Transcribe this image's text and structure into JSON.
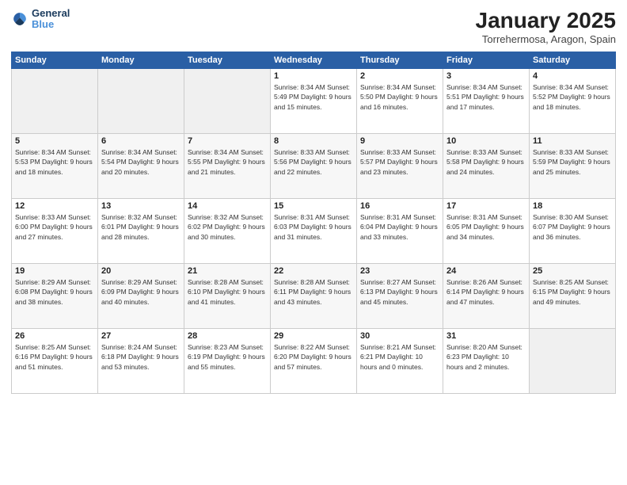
{
  "logo": {
    "line1": "General",
    "line2": "Blue"
  },
  "title": "January 2025",
  "subtitle": "Torrehermosa, Aragon, Spain",
  "days_of_week": [
    "Sunday",
    "Monday",
    "Tuesday",
    "Wednesday",
    "Thursday",
    "Friday",
    "Saturday"
  ],
  "weeks": [
    [
      {
        "day": "",
        "info": ""
      },
      {
        "day": "",
        "info": ""
      },
      {
        "day": "",
        "info": ""
      },
      {
        "day": "1",
        "info": "Sunrise: 8:34 AM\nSunset: 5:49 PM\nDaylight: 9 hours\nand 15 minutes."
      },
      {
        "day": "2",
        "info": "Sunrise: 8:34 AM\nSunset: 5:50 PM\nDaylight: 9 hours\nand 16 minutes."
      },
      {
        "day": "3",
        "info": "Sunrise: 8:34 AM\nSunset: 5:51 PM\nDaylight: 9 hours\nand 17 minutes."
      },
      {
        "day": "4",
        "info": "Sunrise: 8:34 AM\nSunset: 5:52 PM\nDaylight: 9 hours\nand 18 minutes."
      }
    ],
    [
      {
        "day": "5",
        "info": "Sunrise: 8:34 AM\nSunset: 5:53 PM\nDaylight: 9 hours\nand 18 minutes."
      },
      {
        "day": "6",
        "info": "Sunrise: 8:34 AM\nSunset: 5:54 PM\nDaylight: 9 hours\nand 20 minutes."
      },
      {
        "day": "7",
        "info": "Sunrise: 8:34 AM\nSunset: 5:55 PM\nDaylight: 9 hours\nand 21 minutes."
      },
      {
        "day": "8",
        "info": "Sunrise: 8:33 AM\nSunset: 5:56 PM\nDaylight: 9 hours\nand 22 minutes."
      },
      {
        "day": "9",
        "info": "Sunrise: 8:33 AM\nSunset: 5:57 PM\nDaylight: 9 hours\nand 23 minutes."
      },
      {
        "day": "10",
        "info": "Sunrise: 8:33 AM\nSunset: 5:58 PM\nDaylight: 9 hours\nand 24 minutes."
      },
      {
        "day": "11",
        "info": "Sunrise: 8:33 AM\nSunset: 5:59 PM\nDaylight: 9 hours\nand 25 minutes."
      }
    ],
    [
      {
        "day": "12",
        "info": "Sunrise: 8:33 AM\nSunset: 6:00 PM\nDaylight: 9 hours\nand 27 minutes."
      },
      {
        "day": "13",
        "info": "Sunrise: 8:32 AM\nSunset: 6:01 PM\nDaylight: 9 hours\nand 28 minutes."
      },
      {
        "day": "14",
        "info": "Sunrise: 8:32 AM\nSunset: 6:02 PM\nDaylight: 9 hours\nand 30 minutes."
      },
      {
        "day": "15",
        "info": "Sunrise: 8:31 AM\nSunset: 6:03 PM\nDaylight: 9 hours\nand 31 minutes."
      },
      {
        "day": "16",
        "info": "Sunrise: 8:31 AM\nSunset: 6:04 PM\nDaylight: 9 hours\nand 33 minutes."
      },
      {
        "day": "17",
        "info": "Sunrise: 8:31 AM\nSunset: 6:05 PM\nDaylight: 9 hours\nand 34 minutes."
      },
      {
        "day": "18",
        "info": "Sunrise: 8:30 AM\nSunset: 6:07 PM\nDaylight: 9 hours\nand 36 minutes."
      }
    ],
    [
      {
        "day": "19",
        "info": "Sunrise: 8:29 AM\nSunset: 6:08 PM\nDaylight: 9 hours\nand 38 minutes."
      },
      {
        "day": "20",
        "info": "Sunrise: 8:29 AM\nSunset: 6:09 PM\nDaylight: 9 hours\nand 40 minutes."
      },
      {
        "day": "21",
        "info": "Sunrise: 8:28 AM\nSunset: 6:10 PM\nDaylight: 9 hours\nand 41 minutes."
      },
      {
        "day": "22",
        "info": "Sunrise: 8:28 AM\nSunset: 6:11 PM\nDaylight: 9 hours\nand 43 minutes."
      },
      {
        "day": "23",
        "info": "Sunrise: 8:27 AM\nSunset: 6:13 PM\nDaylight: 9 hours\nand 45 minutes."
      },
      {
        "day": "24",
        "info": "Sunrise: 8:26 AM\nSunset: 6:14 PM\nDaylight: 9 hours\nand 47 minutes."
      },
      {
        "day": "25",
        "info": "Sunrise: 8:25 AM\nSunset: 6:15 PM\nDaylight: 9 hours\nand 49 minutes."
      }
    ],
    [
      {
        "day": "26",
        "info": "Sunrise: 8:25 AM\nSunset: 6:16 PM\nDaylight: 9 hours\nand 51 minutes."
      },
      {
        "day": "27",
        "info": "Sunrise: 8:24 AM\nSunset: 6:18 PM\nDaylight: 9 hours\nand 53 minutes."
      },
      {
        "day": "28",
        "info": "Sunrise: 8:23 AM\nSunset: 6:19 PM\nDaylight: 9 hours\nand 55 minutes."
      },
      {
        "day": "29",
        "info": "Sunrise: 8:22 AM\nSunset: 6:20 PM\nDaylight: 9 hours\nand 57 minutes."
      },
      {
        "day": "30",
        "info": "Sunrise: 8:21 AM\nSunset: 6:21 PM\nDaylight: 10 hours\nand 0 minutes."
      },
      {
        "day": "31",
        "info": "Sunrise: 8:20 AM\nSunset: 6:23 PM\nDaylight: 10 hours\nand 2 minutes."
      },
      {
        "day": "",
        "info": ""
      }
    ]
  ]
}
